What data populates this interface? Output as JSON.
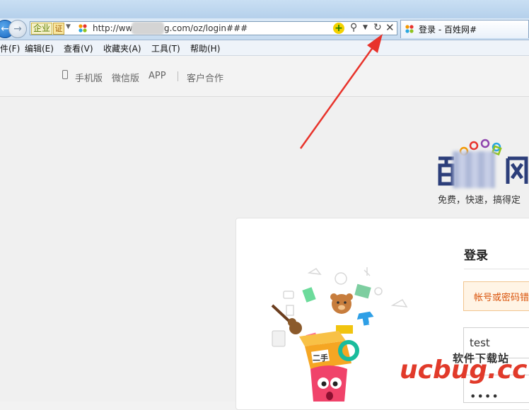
{
  "browser": {
    "cert_label": "企业",
    "cert_verify": "证",
    "url_prefix": "http://ww",
    "url_suffix": "g.com/oz/login###",
    "tab_title": "登录 - 百姓网#"
  },
  "menu": {
    "items": [
      "件(F)",
      "编辑(E)",
      "查看(V)",
      "收藏夹(A)",
      "工具(T)",
      "帮助(H)"
    ]
  },
  "site_nav": {
    "mobile": "手机版",
    "wechat": "微信版",
    "app": "APP",
    "partner": "客户合作"
  },
  "logo": {
    "tagline": "免费，快速，搞得定"
  },
  "login": {
    "title": "登录",
    "error": "帐号或密码错",
    "username_value": "test",
    "password_mask": "••••"
  },
  "illustration": {
    "box_label": "二手"
  },
  "watermark": {
    "top": "软件下载站",
    "main": "ucbug.cc"
  },
  "colors": {
    "accent_arrow": "#e8332b",
    "error_text": "#d9530b",
    "watermark_red": "#e13a2a"
  }
}
